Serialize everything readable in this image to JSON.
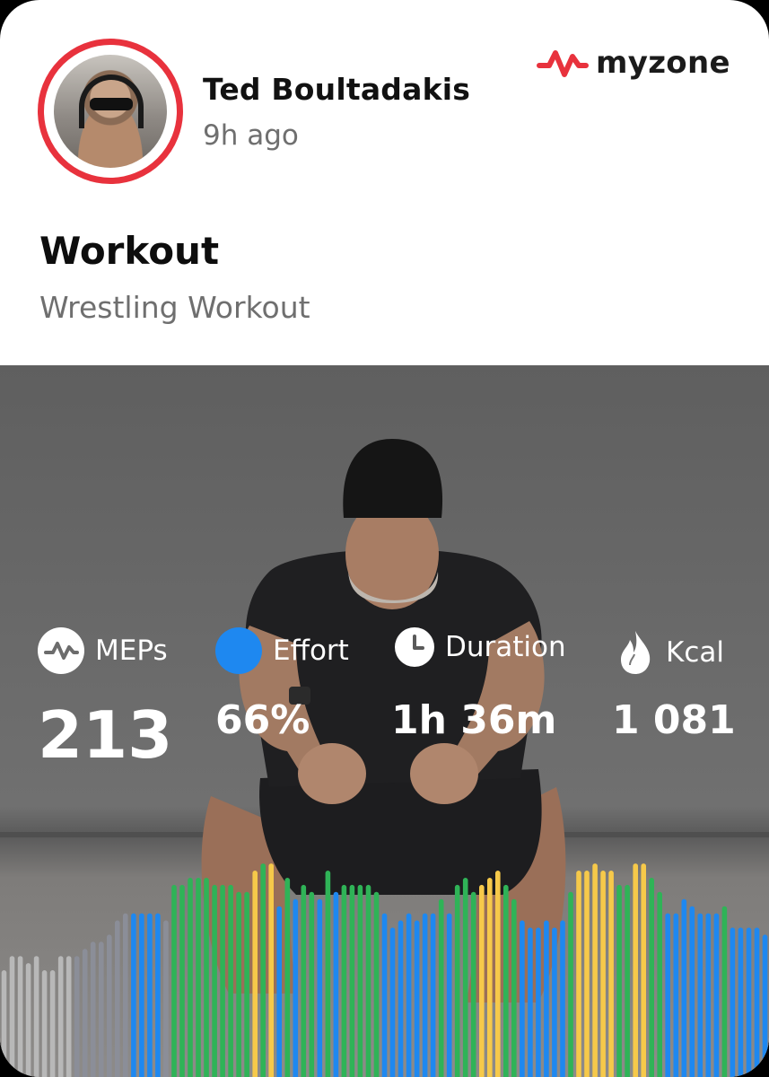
{
  "post": {
    "user_name": "Ted Boultadakis",
    "time_ago": "9h ago",
    "brand": "myzone",
    "title": "Workout",
    "subtitle": "Wrestling Workout"
  },
  "stats": [
    {
      "icon": "meps-icon",
      "label": "MEPs",
      "value": "213"
    },
    {
      "icon": "effort-icon",
      "label": "Effort",
      "value": "66%"
    },
    {
      "icon": "clock-icon",
      "label": "Duration",
      "value": "1h 36m"
    },
    {
      "icon": "flame-icon",
      "label": "Kcal",
      "value": "1 081"
    }
  ],
  "colors": {
    "accent": "#e8323d",
    "zone_gray": "#b8b8b8",
    "zone_slate": "#8b8e98",
    "zone_blue": "#1e88f0",
    "zone_green": "#2fb357",
    "zone_yellow": "#f6c94a",
    "effort_blue": "#1e88f0"
  },
  "zone_bars": {
    "levels": [
      [
        "g",
        0.15
      ],
      [
        "g",
        0.17
      ],
      [
        "g",
        0.17
      ],
      [
        "g",
        0.16
      ],
      [
        "g",
        0.17
      ],
      [
        "g",
        0.15
      ],
      [
        "g",
        0.15
      ],
      [
        "g",
        0.17
      ],
      [
        "g",
        0.17
      ],
      [
        "s",
        0.17
      ],
      [
        "s",
        0.18
      ],
      [
        "s",
        0.19
      ],
      [
        "s",
        0.19
      ],
      [
        "s",
        0.2
      ],
      [
        "s",
        0.22
      ],
      [
        "s",
        0.23
      ],
      [
        "b",
        0.23
      ],
      [
        "b",
        0.23
      ],
      [
        "b",
        0.23
      ],
      [
        "b",
        0.23
      ],
      [
        "s",
        0.22
      ],
      [
        "gr",
        0.27
      ],
      [
        "gr",
        0.27
      ],
      [
        "gr",
        0.28
      ],
      [
        "gr",
        0.28
      ],
      [
        "gr",
        0.28
      ],
      [
        "gr",
        0.27
      ],
      [
        "gr",
        0.27
      ],
      [
        "gr",
        0.27
      ],
      [
        "gr",
        0.26
      ],
      [
        "gr",
        0.26
      ],
      [
        "y",
        0.29
      ],
      [
        "gr",
        0.3
      ],
      [
        "y",
        0.3
      ],
      [
        "b",
        0.24
      ],
      [
        "gr",
        0.28
      ],
      [
        "b",
        0.25
      ],
      [
        "gr",
        0.27
      ],
      [
        "gr",
        0.26
      ],
      [
        "b",
        0.25
      ],
      [
        "gr",
        0.29
      ],
      [
        "b",
        0.26
      ],
      [
        "gr",
        0.27
      ],
      [
        "gr",
        0.27
      ],
      [
        "gr",
        0.27
      ],
      [
        "gr",
        0.27
      ],
      [
        "gr",
        0.26
      ],
      [
        "b",
        0.23
      ],
      [
        "b",
        0.21
      ],
      [
        "b",
        0.22
      ],
      [
        "b",
        0.23
      ],
      [
        "b",
        0.22
      ],
      [
        "b",
        0.23
      ],
      [
        "b",
        0.23
      ],
      [
        "gr",
        0.25
      ],
      [
        "b",
        0.23
      ],
      [
        "gr",
        0.27
      ],
      [
        "gr",
        0.28
      ],
      [
        "gr",
        0.26
      ],
      [
        "y",
        0.27
      ],
      [
        "y",
        0.28
      ],
      [
        "y",
        0.29
      ],
      [
        "gr",
        0.27
      ],
      [
        "gr",
        0.25
      ],
      [
        "b",
        0.22
      ],
      [
        "b",
        0.21
      ],
      [
        "b",
        0.21
      ],
      [
        "b",
        0.22
      ],
      [
        "b",
        0.21
      ],
      [
        "b",
        0.22
      ],
      [
        "gr",
        0.26
      ],
      [
        "y",
        0.29
      ],
      [
        "y",
        0.29
      ],
      [
        "y",
        0.3
      ],
      [
        "y",
        0.29
      ],
      [
        "y",
        0.29
      ],
      [
        "gr",
        0.27
      ],
      [
        "gr",
        0.27
      ],
      [
        "y",
        0.3
      ],
      [
        "y",
        0.3
      ],
      [
        "gr",
        0.28
      ],
      [
        "gr",
        0.26
      ],
      [
        "b",
        0.23
      ],
      [
        "b",
        0.23
      ],
      [
        "b",
        0.25
      ],
      [
        "b",
        0.24
      ],
      [
        "b",
        0.23
      ],
      [
        "b",
        0.23
      ],
      [
        "b",
        0.23
      ],
      [
        "gr",
        0.24
      ],
      [
        "b",
        0.21
      ],
      [
        "b",
        0.21
      ],
      [
        "b",
        0.21
      ],
      [
        "b",
        0.21
      ],
      [
        "b",
        0.2
      ]
    ]
  }
}
